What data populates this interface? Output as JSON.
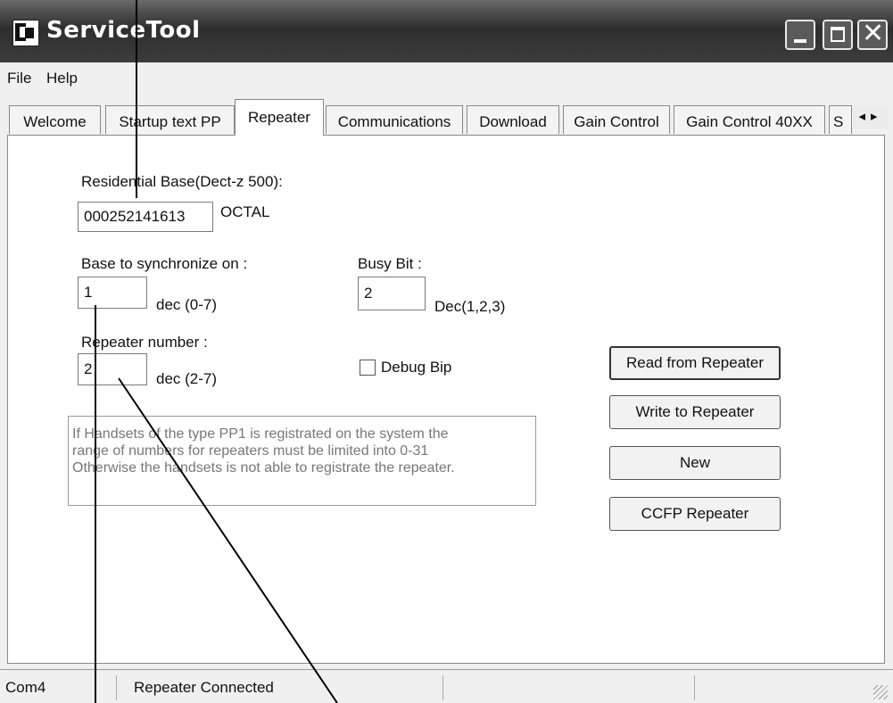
{
  "window": {
    "title": "ServiceTool",
    "icon": "app-icon",
    "controls": [
      "minimize-icon",
      "maximize-icon",
      "close-icon"
    ]
  },
  "menu": {
    "file": "File",
    "help": "Help"
  },
  "tabs": [
    "Welcome",
    "Startup text PP",
    "Repeater",
    "Communications",
    "Download",
    "Gain Control",
    "Gain Control 40XX",
    "S"
  ],
  "active_tab": "Repeater",
  "tab_scroll": {
    "left": "◂",
    "right": "▸"
  },
  "form": {
    "residential_base_label": "Residential Base(Dect-z 500):",
    "residential_base_value": "000252141613",
    "octal_label": "OCTAL",
    "base_sync_label": "Base to synchronize on :",
    "base_sync_value": "1",
    "base_sync_hint": "dec (0-7)",
    "busy_bit_label": "Busy Bit :",
    "busy_bit_value": "2",
    "busy_bit_hint": "Dec(1,2,3)",
    "repeater_number_label": "Repeater number :",
    "repeater_number_value": "2",
    "repeater_number_hint": "dec (2-7)",
    "debug_bip_label": "Debug Bip",
    "debug_bip_checked": false
  },
  "info_text": [
    "If Handsets of the type PP1 is registrated on the system the",
    "range of numbers for repeaters must be limited into 0-31",
    "Otherwise the handsets is not able to registrate the repeater."
  ],
  "buttons": {
    "read": "Read from Repeater",
    "write": "Write to Repeater",
    "new": "New",
    "ccfp": "CCFP Repeater"
  },
  "status": {
    "port": "Com4",
    "connection": "Repeater Connected"
  }
}
